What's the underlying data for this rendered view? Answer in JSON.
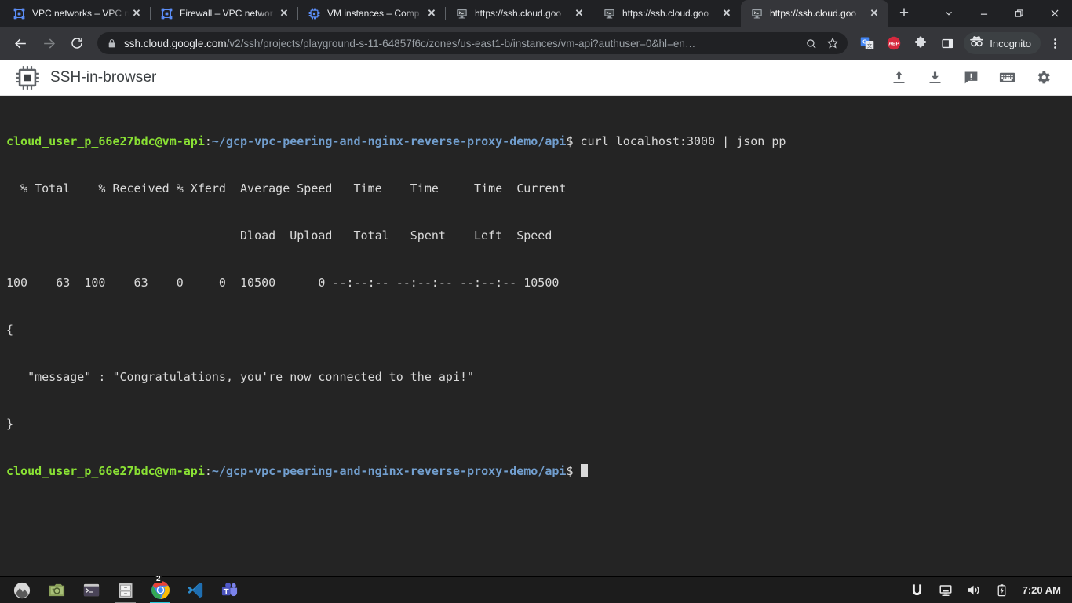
{
  "browser": {
    "tabs": [
      {
        "title": "VPC networks – VPC netw",
        "icon": "vpc-network-icon",
        "active": false
      },
      {
        "title": "Firewall – VPC networ",
        "icon": "vpc-network-icon",
        "active": false
      },
      {
        "title": "VM instances – Comp",
        "icon": "compute-chip-icon",
        "active": false
      },
      {
        "title": "https://ssh.cloud.goo",
        "icon": "ssh-terminal-icon",
        "active": false
      },
      {
        "title": "https://ssh.cloud.goo",
        "icon": "ssh-terminal-icon",
        "active": false
      },
      {
        "title": "https://ssh.cloud.goo",
        "icon": "ssh-terminal-icon",
        "active": true
      }
    ],
    "new_tab_label": "+",
    "close_label": "✕",
    "window_controls": {
      "tab_search": "chevron-down-icon",
      "minimize": "minimize-icon",
      "maximize": "restore-icon",
      "close": "close-icon"
    },
    "nav": {
      "back": "back-arrow-icon",
      "forward": "forward-arrow-icon",
      "reload": "reload-icon"
    },
    "omnibox": {
      "host": "ssh.cloud.google.com",
      "path": "/v2/ssh/projects/playground-s-11-64857f6c/zones/us-east1-b/instances/vm-api?authuser=0&hl=en…",
      "full_url": "ssh.cloud.google.com/v2/ssh/projects/playground-s-11-64857f6c/zones/us-east1-b/instances/vm-api?authuser=0&hl=en…",
      "lock_icon": "lock-icon",
      "search_icon": "search-magnifier-icon",
      "bookmark_icon": "star-icon"
    },
    "extensions": [
      {
        "name": "google-translate-icon",
        "label": "G"
      },
      {
        "name": "adblock-plus-icon",
        "label": "ABP"
      },
      {
        "name": "extensions-puzzle-icon",
        "label": ""
      },
      {
        "name": "side-panel-icon",
        "label": ""
      }
    ],
    "incognito": {
      "label": "Incognito",
      "icon": "incognito-spy-icon"
    },
    "menu_icon": "kebab-menu-icon"
  },
  "ssh_app": {
    "title": "SSH-in-browser",
    "logo_icon": "compute-chip-icon",
    "actions": [
      {
        "name": "upload-file-button",
        "icon": "upload-icon"
      },
      {
        "name": "download-file-button",
        "icon": "download-icon"
      },
      {
        "name": "report-issue-button",
        "icon": "feedback-icon"
      },
      {
        "name": "keyboard-shortcuts-button",
        "icon": "keyboard-icon"
      },
      {
        "name": "settings-button",
        "icon": "gear-icon"
      }
    ]
  },
  "terminal": {
    "prompt": {
      "user_host": "cloud_user_p_66e27bdc@vm-api",
      "separator": ":",
      "path": "~/gcp-vpc-peering-and-nginx-reverse-proxy-demo/api",
      "sigil": "$"
    },
    "command": " curl localhost:3000 | json_pp",
    "output_lines": [
      "  % Total    % Received % Xferd  Average Speed   Time    Time     Time  Current",
      "                                 Dload  Upload   Total   Spent    Left  Speed",
      "100    63  100    63    0     0  10500      0 --:--:-- --:--:-- --:--:-- 10500",
      "{",
      "   \"message\" : \"Congratulations, you're now connected to the api!\"",
      "}"
    ],
    "colors": {
      "background": "#242424",
      "foreground": "#d9d9d9",
      "user_host": "#8ae234",
      "path": "#729fcf"
    },
    "cursor": "block-cursor"
  },
  "taskbar": {
    "apps": [
      {
        "name": "show-apps-icon",
        "badge": "",
        "active": false
      },
      {
        "name": "screenshot-tool-icon",
        "badge": "",
        "active": false
      },
      {
        "name": "terminal-app-icon",
        "badge": "",
        "active": false
      },
      {
        "name": "file-manager-icon",
        "badge": "",
        "active": true
      },
      {
        "name": "google-chrome-icon",
        "badge": "2",
        "active": true
      },
      {
        "name": "vscode-icon",
        "badge": "",
        "active": false
      },
      {
        "name": "microsoft-teams-icon",
        "badge": "",
        "active": false
      }
    ],
    "tray": [
      {
        "name": "unifi-icon"
      },
      {
        "name": "display-icon"
      },
      {
        "name": "volume-icon"
      },
      {
        "name": "battery-charging-icon"
      }
    ],
    "clock": "7:20 AM"
  }
}
